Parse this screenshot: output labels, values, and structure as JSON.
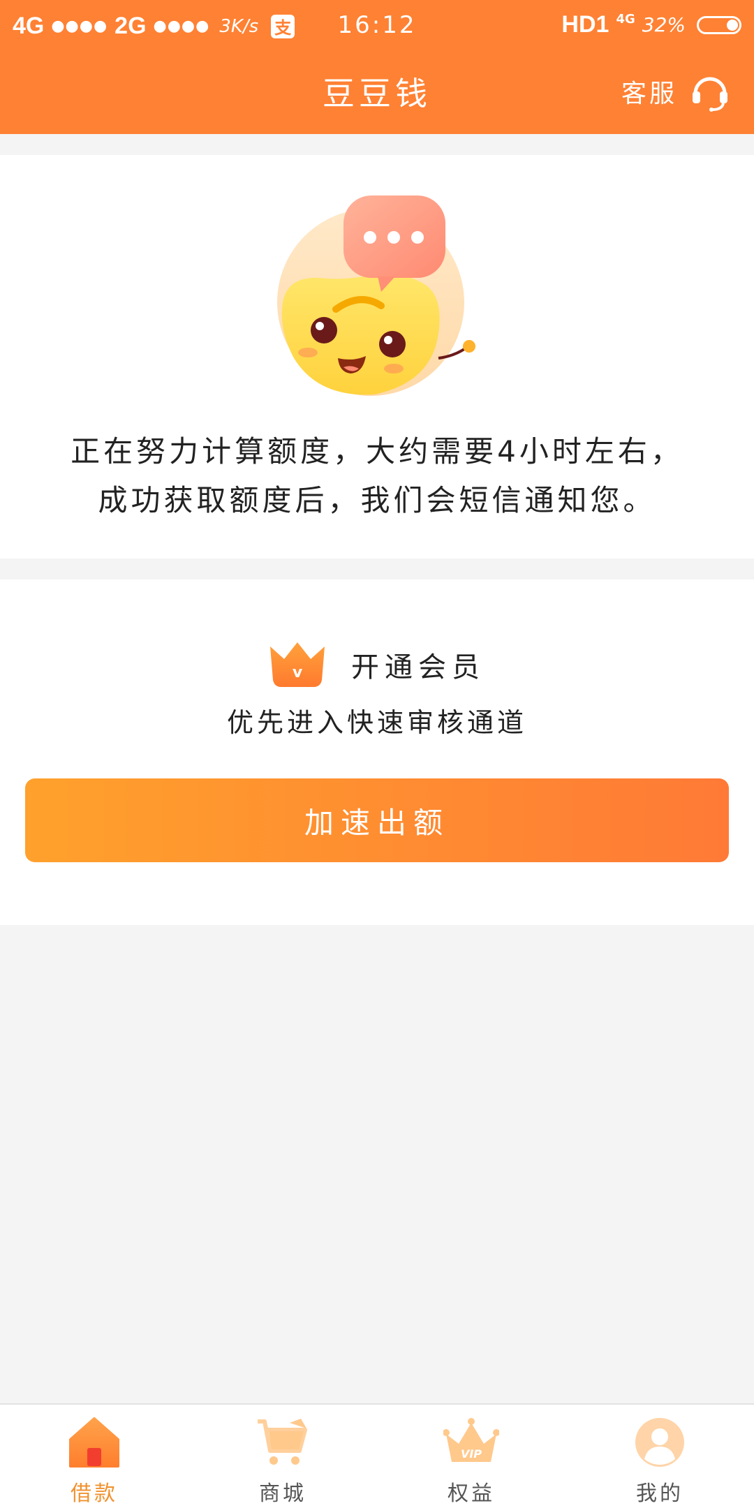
{
  "status_bar": {
    "network1": "4G",
    "network2": "2G",
    "dots": "●●●●",
    "speed": "3K/s",
    "app_icon_char": "支",
    "time": "16:12",
    "hd": "HD1",
    "net_type": "4G",
    "battery": "32%"
  },
  "header": {
    "title": "豆豆钱",
    "service_label": "客服"
  },
  "status_card": {
    "line1": "正在努力计算额度，大约需要4小时左右，",
    "line2": "成功获取额度后，我们会短信通知您。"
  },
  "member_card": {
    "title": "开通会员",
    "subtitle": "优先进入快速审核通道",
    "crown_mark": "v",
    "button_label": "加速出额"
  },
  "bottom_nav": {
    "items": [
      {
        "label": "借款",
        "icon": "home-icon",
        "active": true
      },
      {
        "label": "商城",
        "icon": "cart-icon",
        "active": false
      },
      {
        "label": "权益",
        "icon": "vip-crown-icon",
        "active": false
      },
      {
        "label": "我的",
        "icon": "profile-icon",
        "active": false
      }
    ],
    "vip_text": "VIP"
  },
  "colors": {
    "brand": "#ff8133",
    "button_start": "#ffa12c",
    "button_end": "#ff7a36",
    "active_nav": "#f0922f"
  }
}
